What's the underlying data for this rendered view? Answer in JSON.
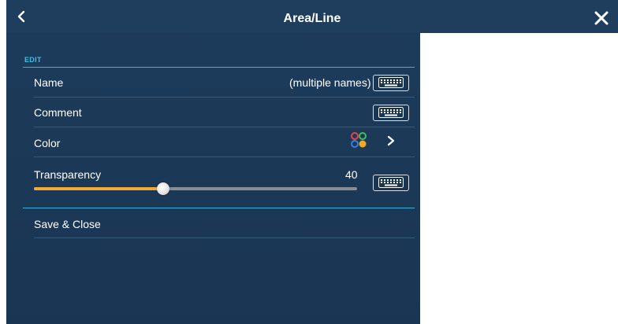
{
  "header": {
    "title": "Area/Line",
    "back_icon": "chevron-left-icon",
    "close_icon": "close-icon"
  },
  "edit": {
    "section_label": "EDIT",
    "name": {
      "label": "Name",
      "value": "(multiple names)"
    },
    "comment": {
      "label": "Comment",
      "value": ""
    },
    "color": {
      "label": "Color",
      "palette_colors": [
        "#e84545",
        "#3fbf5f",
        "#3b7fe0",
        "#f5a623"
      ]
    },
    "transparency": {
      "label": "Transparency",
      "value": "40",
      "level_fraction": 0.4
    },
    "save_label": "Save & Close"
  },
  "colors": {
    "panel_bg": "#1d3b5b",
    "accent_line": "#3fb2d9",
    "section_label": "#3fc0e8",
    "slider_fill": "#f2a832"
  }
}
